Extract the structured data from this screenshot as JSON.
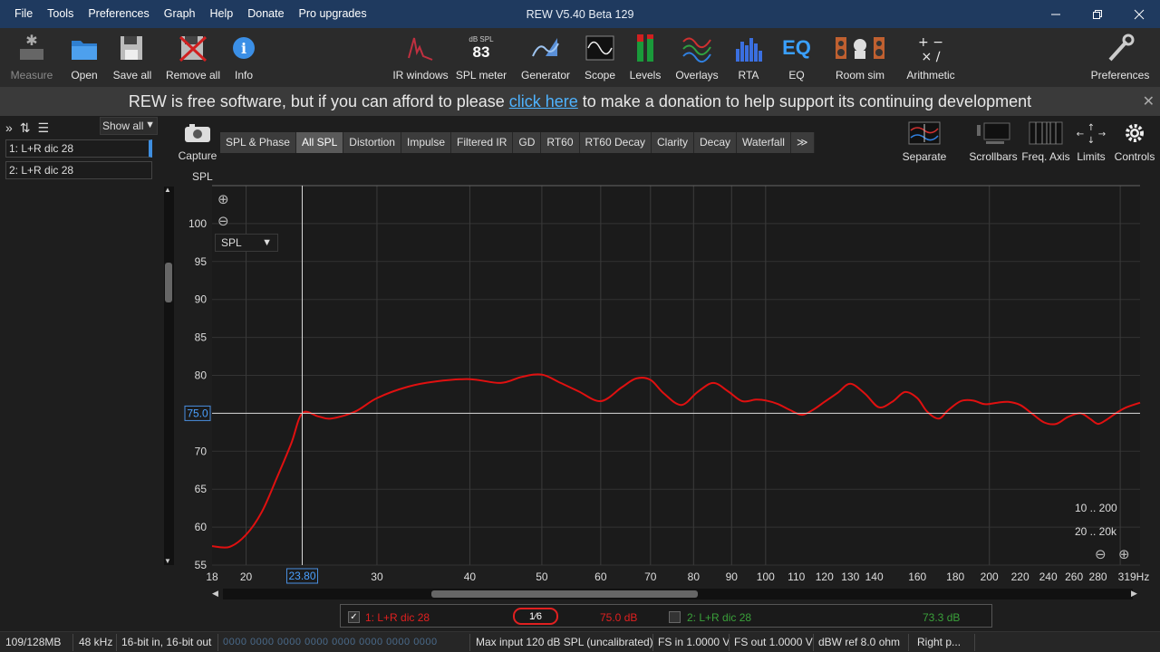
{
  "app": {
    "title": "REW V5.40 Beta 129",
    "menus": [
      "File",
      "Tools",
      "Preferences",
      "Graph",
      "Help",
      "Donate",
      "Pro upgrades"
    ]
  },
  "toolbar": {
    "measure": "Measure",
    "open": "Open",
    "save_all": "Save all",
    "remove_all": "Remove all",
    "info": "Info",
    "ir_windows": "IR windows",
    "spl_meter": "SPL meter",
    "spl_meter_unit": "dB SPL",
    "spl_meter_value": "83",
    "generator": "Generator",
    "scope": "Scope",
    "levels": "Levels",
    "overlays": "Overlays",
    "rta": "RTA",
    "eq": "EQ",
    "eq_icon_text": "EQ",
    "room_sim": "Room sim",
    "arithmetic": "Arithmetic",
    "preferences": "Preferences"
  },
  "banner": {
    "before": "REW is free software, but if you can afford to please",
    "link": "click here",
    "after": "to make a donation to help support its continuing development",
    "close": "✕"
  },
  "left_panel": {
    "show_all": "Show all",
    "measurements": [
      "1: L+R dic 28",
      "2: L+R dic 28"
    ]
  },
  "graph_toolbar": {
    "capture": "Capture",
    "tabs": [
      "SPL & Phase",
      "All SPL",
      "Distortion",
      "Impulse",
      "Filtered IR",
      "GD",
      "RT60",
      "RT60 Decay",
      "Clarity",
      "Decay",
      "Waterfall",
      "≫"
    ],
    "active_tab": "All SPL",
    "separate": "Separate",
    "scrollbars": "Scrollbars",
    "freq_axis": "Freq. Axis",
    "limits": "Limits",
    "controls": "Controls"
  },
  "plot": {
    "y_axis_label": "SPL",
    "y_selector": "SPL",
    "cursor_x_readout": "23.80",
    "cursor_y_readout": "75.0",
    "range_buttons": [
      "10 .. 200",
      "20 .. 20k"
    ]
  },
  "chart_data": {
    "type": "line",
    "ylabel": "SPL",
    "x_scale": "log",
    "xlim": [
      18,
      319
    ],
    "ylim": [
      55,
      105
    ],
    "x_ticks": [
      "18",
      "20",
      "30",
      "40",
      "50",
      "60",
      "70",
      "80",
      "90",
      "100",
      "110",
      "120",
      "130",
      "140",
      "160",
      "180",
      "200",
      "220",
      "240",
      "260",
      "280",
      "319Hz"
    ],
    "x_tick_values": [
      18,
      20,
      30,
      40,
      50,
      60,
      70,
      80,
      90,
      100,
      110,
      120,
      130,
      140,
      160,
      180,
      200,
      220,
      240,
      260,
      280,
      319
    ],
    "y_ticks": [
      55,
      60,
      65,
      70,
      75,
      80,
      85,
      90,
      95,
      100
    ],
    "grid": true,
    "cursor": {
      "x": 23.8,
      "y": 75.0
    },
    "series": [
      {
        "name": "1: L+R dic 28",
        "color": "#e01010",
        "x": [
          18,
          19,
          20,
          21,
          22,
          23,
          23.8,
          25,
          26,
          28,
          30,
          33,
          36,
          40,
          44,
          47,
          50,
          53,
          56,
          60,
          64,
          67,
          70,
          73,
          77,
          81,
          85,
          89,
          93,
          97,
          100,
          104,
          108,
          112,
          116,
          120,
          125,
          130,
          136,
          142,
          148,
          154,
          160,
          165,
          171,
          176,
          183,
          190,
          197,
          205,
          212,
          220,
          228,
          237,
          246,
          255,
          265,
          273,
          280,
          288,
          297,
          306,
          319
        ],
        "values": [
          57.5,
          57.4,
          59.0,
          62.0,
          66.5,
          71.0,
          75.0,
          74.6,
          74.3,
          75.2,
          77.0,
          78.5,
          79.2,
          79.5,
          79.0,
          79.8,
          80.1,
          79.0,
          77.9,
          76.6,
          78.4,
          79.6,
          79.4,
          77.6,
          76.1,
          77.8,
          79.0,
          77.9,
          76.6,
          76.8,
          76.7,
          76.2,
          75.4,
          74.8,
          75.5,
          76.5,
          77.7,
          78.9,
          77.6,
          75.8,
          76.5,
          77.8,
          77.0,
          75.2,
          74.3,
          75.4,
          76.6,
          76.7,
          76.2,
          76.4,
          76.5,
          76.1,
          75.0,
          73.8,
          73.6,
          74.5,
          75.0,
          74.3,
          73.6,
          74.2,
          75.1,
          75.8,
          76.4
        ]
      },
      {
        "name": "2: L+R dic 28",
        "color": "#3aa03a",
        "visible": false
      }
    ]
  },
  "legend": {
    "item1": "1: L+R dic 28",
    "item1_value": "75.0 dB",
    "smoothing": "1⁄6",
    "item2": "2: L+R dic 28",
    "item2_value": "73.3 dB"
  },
  "status": {
    "memory": "109/128MB",
    "rate": "48 kHz",
    "bits": "16-bit in, 16-bit out",
    "dim": "0000 0000  0000 0000  0000 0000  0000 0000",
    "max_input": "Max input 120 dB SPL (uncalibrated)",
    "fs_in": "FS in 1.0000 V",
    "fs_out": "FS out 1.0000 V",
    "dbw": "dBW ref 8.0 ohm",
    "right": "Right p..."
  },
  "colors": {
    "titlebar": "#1f3a5f",
    "toolbar": "#2b2b2b",
    "banner": "#3a3a3a",
    "link": "#4fb3ff",
    "trace": "#e01010",
    "accent": "#3e8ee0"
  }
}
